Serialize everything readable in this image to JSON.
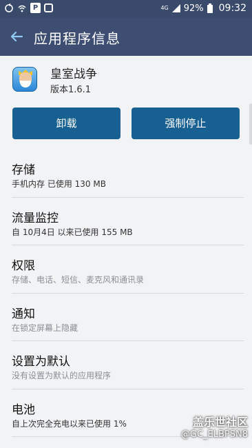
{
  "status_bar": {
    "network": "4G",
    "battery": "92%",
    "time": "09:32"
  },
  "app_bar": {
    "title": "应用程序信息",
    "back_icon": "back-arrow-icon"
  },
  "app": {
    "name": "皇室战争",
    "version": "版本1.6.1"
  },
  "buttons": {
    "uninstall": "卸载",
    "force_stop": "强制停止"
  },
  "items": [
    {
      "title": "存储",
      "subtitle": "手机内存 已使用 130 MB",
      "muted": false
    },
    {
      "title": "流量监控",
      "subtitle": "自 10月4日 以来已使用 155 MB",
      "muted": false
    },
    {
      "title": "权限",
      "subtitle": "存储、电话、短信、麦克风和通讯录",
      "muted": true
    },
    {
      "title": "通知",
      "subtitle": "在锁定屏幕上隐藏",
      "muted": true
    },
    {
      "title": "设置为默认",
      "subtitle": "没有设置为默认的应用程序",
      "muted": true
    },
    {
      "title": "电池",
      "subtitle": "自上次完全充电以来已使用 1%",
      "muted": false
    }
  ],
  "watermark": {
    "line1": "盖乐世社区",
    "line2": "@GC_ELBPSN8"
  }
}
